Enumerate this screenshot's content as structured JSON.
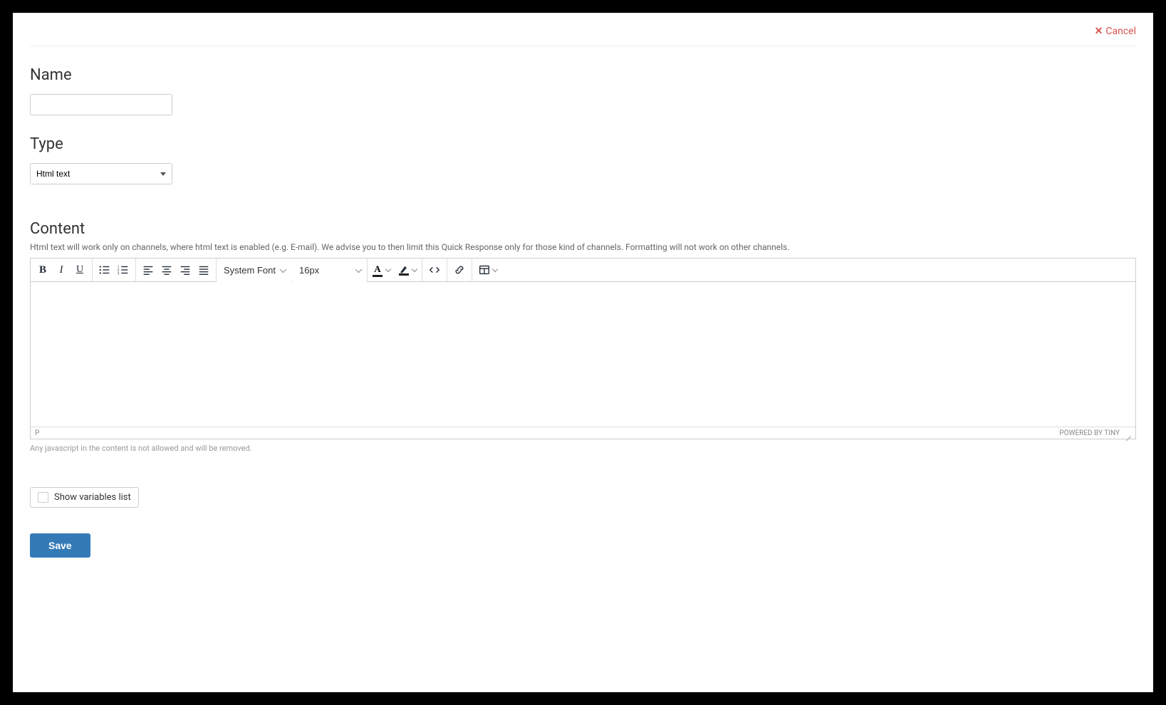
{
  "header": {
    "cancel_label": "Cancel"
  },
  "name": {
    "label": "Name",
    "value": ""
  },
  "type": {
    "label": "Type",
    "selected": "Html text"
  },
  "content": {
    "label": "Content",
    "help": "Html text will work only on channels, where html text is enabled (e.g. E-mail). We advise you to then limit this Quick Response only for those kind of channels. Formatting will not work on other channels.",
    "toolbar": {
      "font_family": "System Font",
      "font_size": "16px"
    },
    "status_path": "P",
    "powered_by": "POWERED BY TINY",
    "footnote": "Any javascript in the content is not allowed and will be removed."
  },
  "variables": {
    "checkbox_label": "Show variables list",
    "checked": false
  },
  "actions": {
    "save_label": "Save"
  }
}
